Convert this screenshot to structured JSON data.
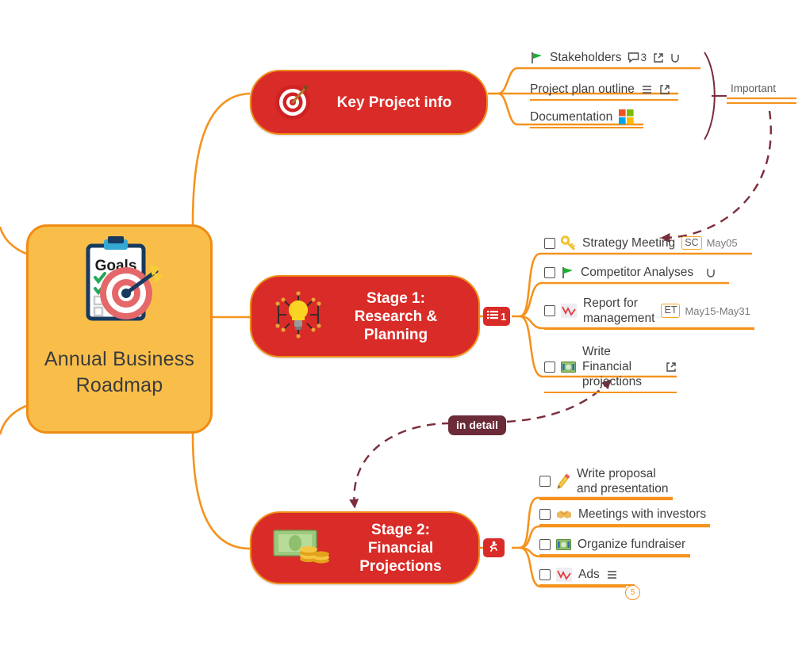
{
  "mindmap": {
    "title": "Annual Business Roadmap",
    "central": {
      "label": "Annual\nBusiness\nRoadmap",
      "icon": "goals-clipboard-target-icon",
      "clipboard_heading": "Goals",
      "fill_color": "#F9BE4A",
      "border_color": "#F08C15"
    },
    "branch_color": "#F5931E",
    "node_color": "#D92B27",
    "nodes": [
      {
        "id": "key-project-info",
        "label": "Key Project info",
        "icon": "dartboard-target-icon",
        "children": [
          {
            "id": "stakeholders",
            "label": "Stakeholders",
            "icon": "green-flag-icon",
            "comment_count": "3",
            "has_link": true,
            "has_hook": true
          },
          {
            "id": "project-plan-outline",
            "label": "Project plan outline",
            "has_notes": true,
            "has_link": true
          },
          {
            "id": "documentation",
            "label": "Documentation",
            "icon": "microsoft-squares-icon"
          }
        ]
      },
      {
        "id": "stage-1",
        "label": "Stage 1:\nResearch &\nPlanning",
        "icon": "lightbulb-network-icon",
        "badge": {
          "icon": "task-list-icon",
          "count": "1"
        },
        "children": [
          {
            "id": "strategy-meeting",
            "label": "Strategy Meeting",
            "icon": "key-icon",
            "checkbox": true,
            "assignee": "SC",
            "date": "May05"
          },
          {
            "id": "competitor-analyses",
            "label": "Competitor Analyses",
            "icon": "green-flag-icon",
            "checkbox": true,
            "has_hook": true
          },
          {
            "id": "report-for-management",
            "label": "Report for\nmanagement",
            "icon": "chart-down-icon",
            "checkbox": true,
            "assignee": "ET",
            "date": "May15-May31"
          },
          {
            "id": "write-financial-projections",
            "label": "Write Financial\nprojections",
            "icon": "money-banknote-icon",
            "checkbox": true,
            "has_link": true
          }
        ]
      },
      {
        "id": "stage-2",
        "label": "Stage 2:\nFinancial\nProjections",
        "icon": "cash-coins-icon",
        "badge": {
          "icon": "runner-icon",
          "count": ""
        },
        "children": [
          {
            "id": "write-proposal",
            "label": "Write proposal\nand presentation",
            "icon": "pencil-icon",
            "checkbox": true
          },
          {
            "id": "meetings-with-investors",
            "label": "Meetings with investors",
            "icon": "handshake-icon",
            "checkbox": true
          },
          {
            "id": "organize-fundraiser",
            "label": "Organize fundraiser",
            "icon": "money-banknote-icon",
            "checkbox": true
          },
          {
            "id": "ads",
            "label": "Ads",
            "icon": "chart-down-icon",
            "checkbox": true,
            "has_notes": true,
            "collapsed_count": "5"
          }
        ]
      }
    ],
    "annotations": {
      "boundary_label": "Important",
      "relationship_label": "in detail",
      "relationship_color": "#6B2B38"
    }
  }
}
